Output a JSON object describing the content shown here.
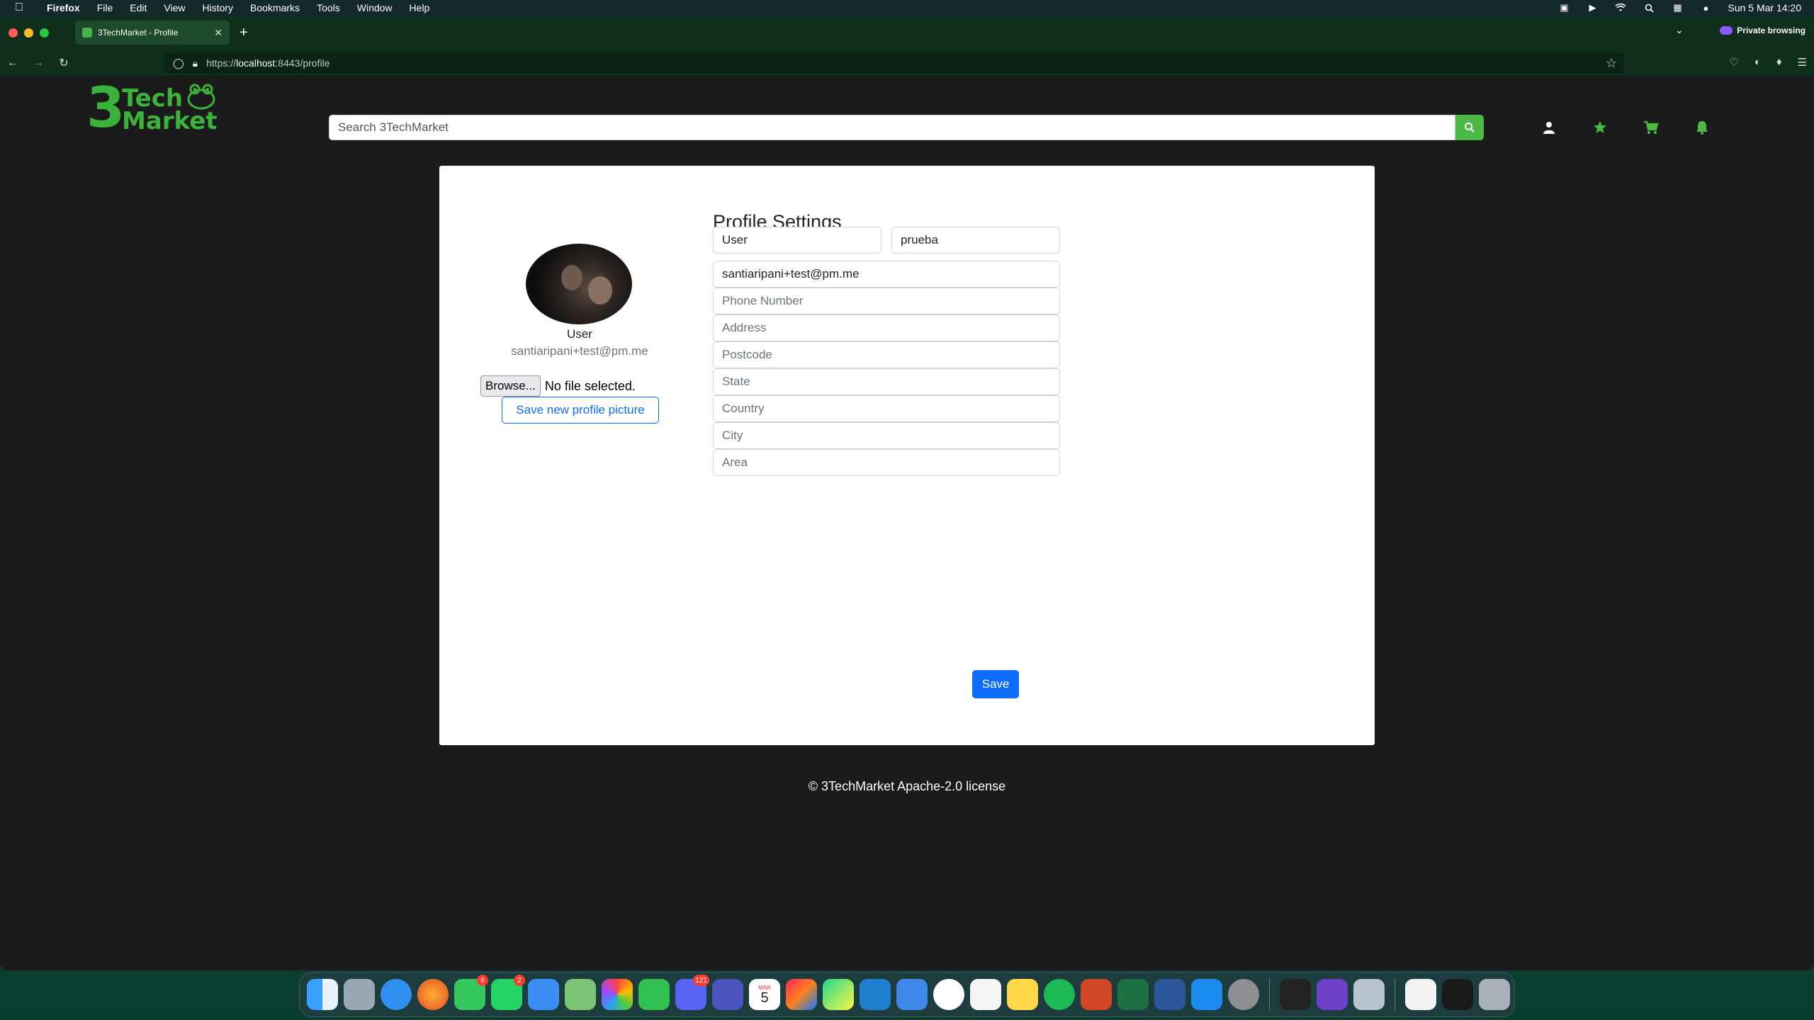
{
  "menubar": {
    "app": "Firefox",
    "items": [
      "File",
      "Edit",
      "View",
      "History",
      "Bookmarks",
      "Tools",
      "Window",
      "Help"
    ],
    "clock": "Sun 5 Mar  14:20"
  },
  "browser": {
    "tab_title": "3TechMarket - Profile",
    "url_scheme": "https://",
    "url_host": "localhost",
    "url_rest": ":8443/profile",
    "private_label": "Private browsing"
  },
  "site": {
    "logo_digit": "3",
    "logo_line1": "Tech",
    "logo_line2": "Market",
    "search_placeholder": "Search 3TechMarket"
  },
  "profile": {
    "name": "User",
    "email": "santiaripani+test@pm.me",
    "browse_label": "Browse...",
    "file_status": "No file selected.",
    "save_picture_label": "Save new profile picture"
  },
  "form": {
    "title": "Profile Settings",
    "first_name": "User",
    "last_name": "prueba",
    "email": "santiaripani+test@pm.me",
    "phone_placeholder": "Phone Number",
    "address_placeholder": "Address",
    "postcode_placeholder": "Postcode",
    "state_placeholder": "State",
    "country_placeholder": "Country",
    "city_placeholder": "City",
    "area_placeholder": "Area",
    "save_label": "Save"
  },
  "footer": {
    "text": "© 3TechMarket Apache-2.0 license"
  },
  "dock": {
    "badges": {
      "messages": "6",
      "whatsapp": "2",
      "discord": "121"
    },
    "calendar_month": "MAR",
    "calendar_day": "5"
  },
  "colors": {
    "brand_green": "#3bb33b",
    "primary_blue": "#0d6efd",
    "page_bg": "#1b1b1b"
  }
}
